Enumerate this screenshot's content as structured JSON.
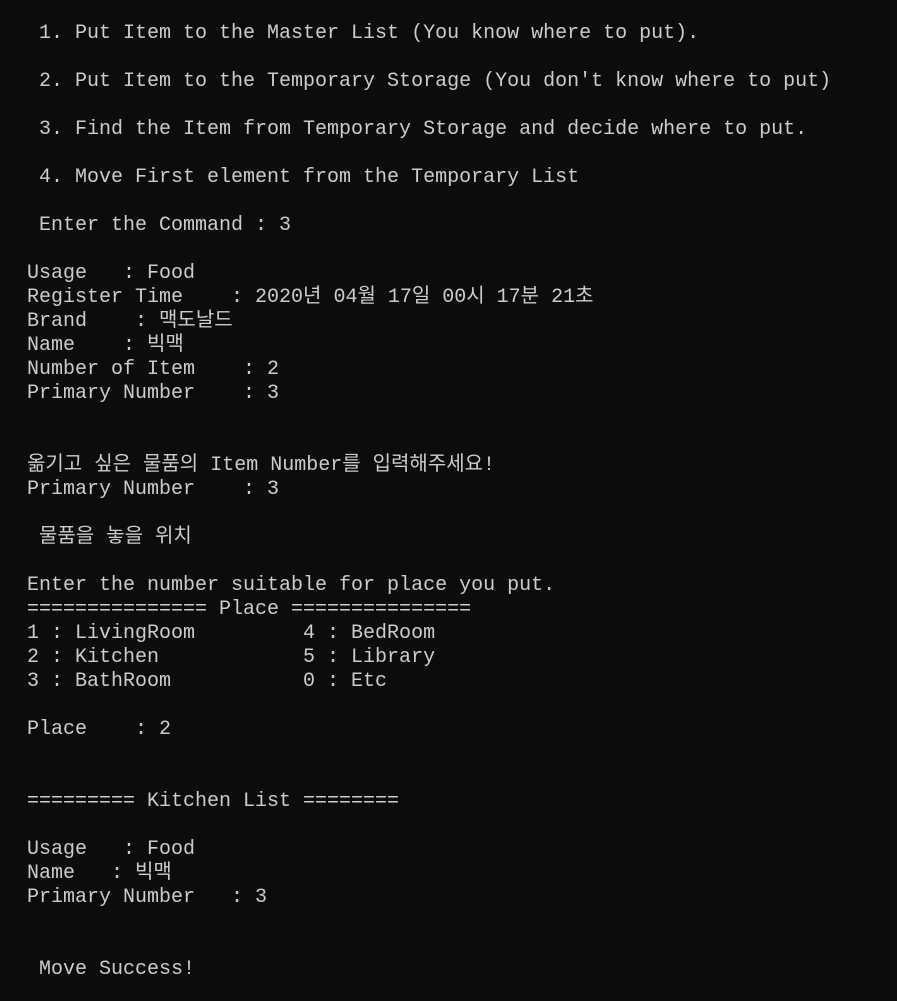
{
  "menu": [
    " 1. Put Item to the Master List (You know where to put).",
    " 2. Put Item to the Temporary Storage (You don't know where to put)",
    " 3. Find the Item from Temporary Storage and decide where to put.",
    " 4. Move First element from the Temporary List"
  ],
  "command_prompt": " Enter the Command : 3",
  "item_detail": {
    "usage": "Usage   : Food",
    "register_time": "Register Time    : 2020년 04월 17일 00시 17분 21초",
    "brand": "Brand    : 맥도날드",
    "name": "Name    : 빅맥",
    "number_of_item": "Number of Item    : 2",
    "primary_number": "Primary Number    : 3"
  },
  "move_prompt": "옮기고 싶은 물품의 Item Number를 입력해주세요!",
  "move_primary_number": "Primary Number    : 3",
  "place_heading": " 물품을 놓을 위치",
  "place_instruction": "Enter the number suitable for place you put.",
  "place_header": "=============== Place ===============",
  "place_rows": [
    "1 : LivingRoom         4 : BedRoom",
    "2 : Kitchen            5 : Library",
    "3 : BathRoom           0 : Etc"
  ],
  "place_input": "Place    : 2",
  "kitchen_header": "========= Kitchen List ========",
  "kitchen_item": {
    "usage": "Usage   : Food",
    "name": "Name   : 빅맥",
    "primary_number": "Primary Number   : 3"
  },
  "result": " Move Success!"
}
